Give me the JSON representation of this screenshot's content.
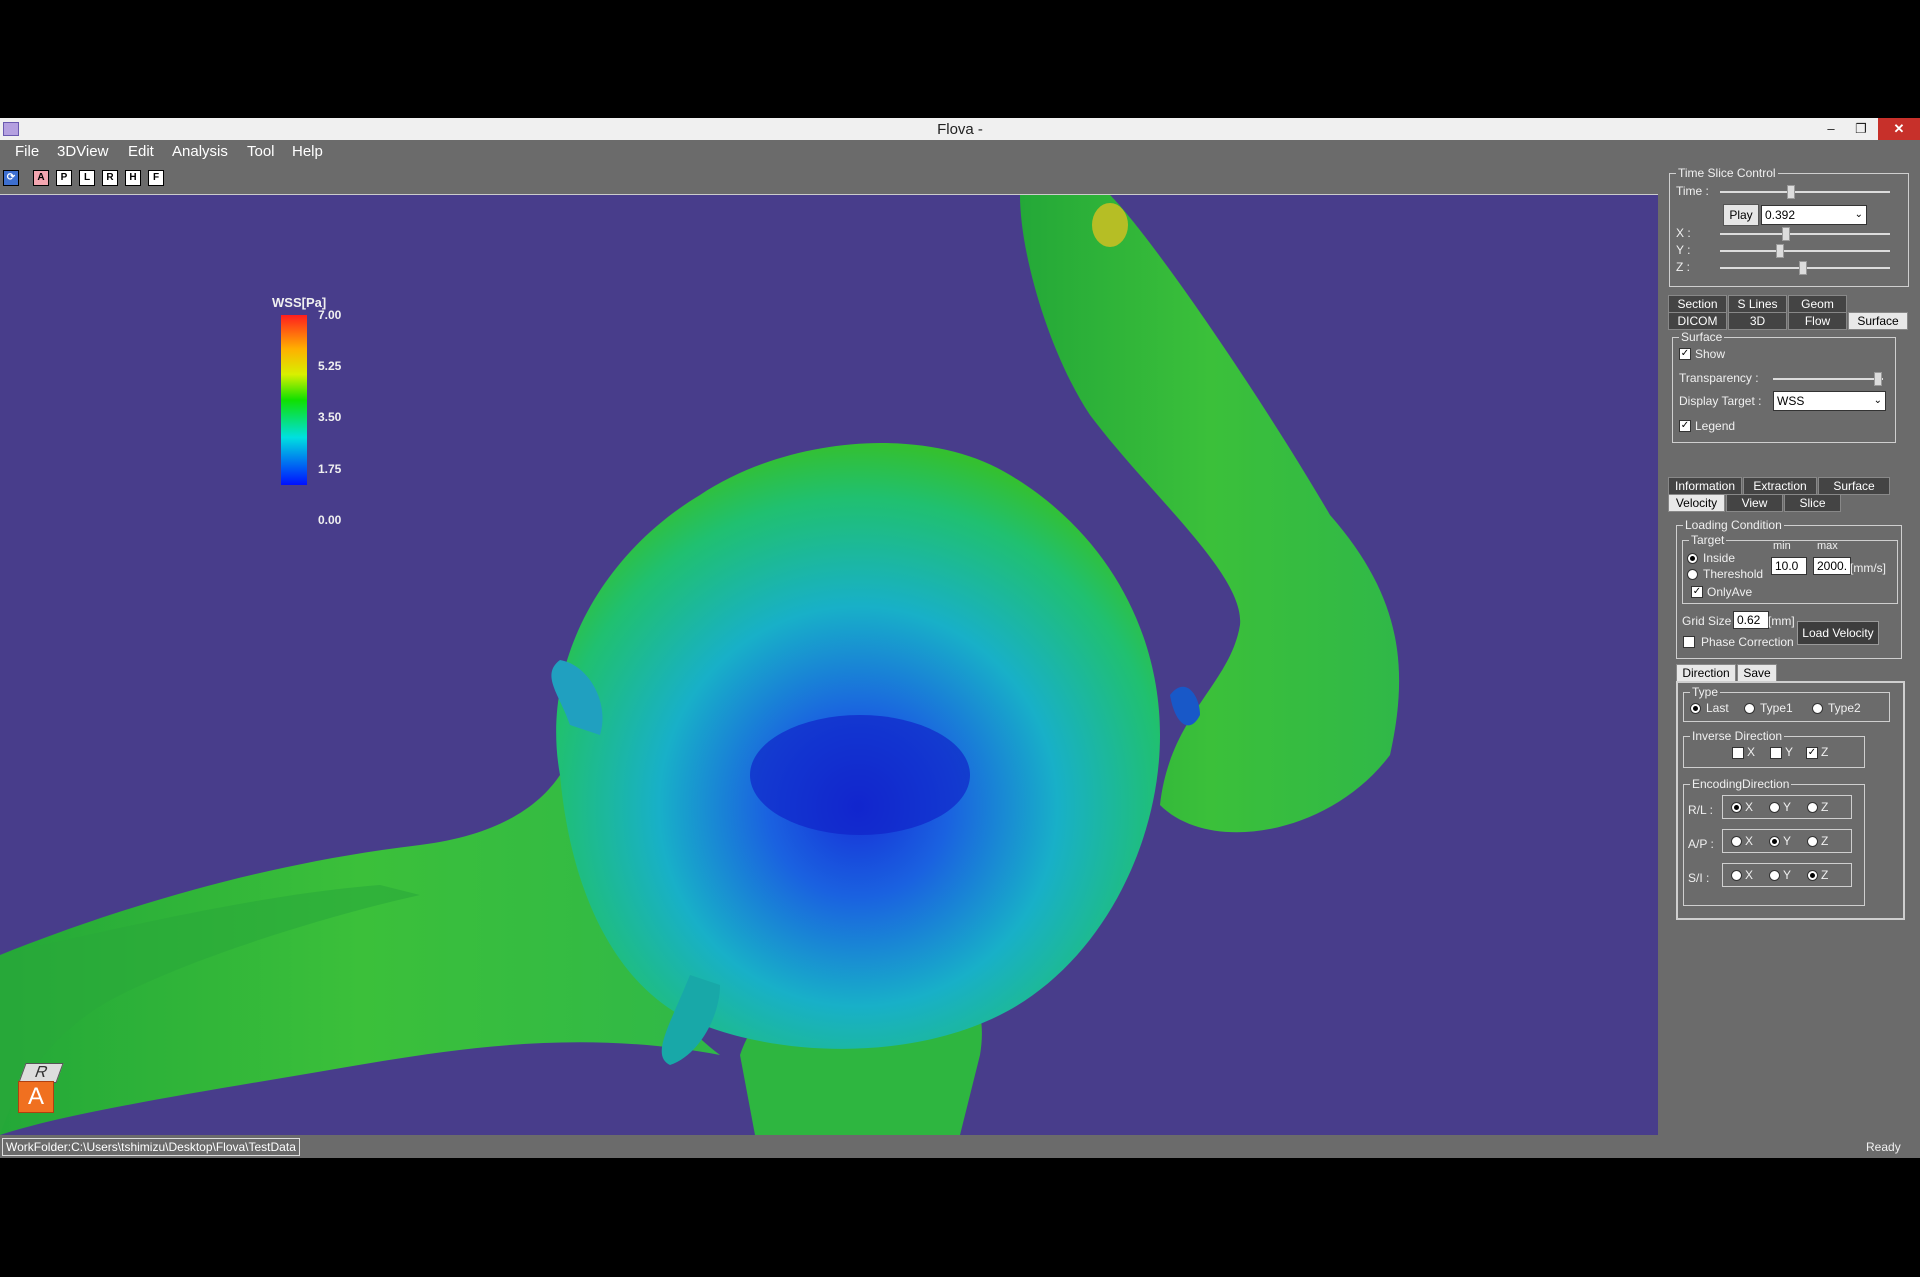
{
  "window": {
    "title": "Flova -",
    "close": "✕",
    "minimize": "–",
    "maximize": "❐"
  },
  "menu": [
    "File",
    "3DView",
    "Edit",
    "Analysis",
    "Tool",
    "Help"
  ],
  "toolbar": [
    "A",
    "P",
    "L",
    "R",
    "H",
    "F"
  ],
  "legend": {
    "title": "WSS[Pa]",
    "ticks": [
      "7.00",
      "5.25",
      "3.50",
      "1.75",
      "0.00"
    ]
  },
  "orientation_cube": {
    "top": "R",
    "front": "A"
  },
  "time_slice": {
    "title": "Time Slice Control",
    "time_label": "Time :",
    "play": "Play",
    "time_value": "0.392",
    "x_label": "X :",
    "y_label": "Y :",
    "z_label": "Z :",
    "time_level": 0.42,
    "x_level": 0.39,
    "y_level": 0.35,
    "z_level": 0.49
  },
  "tabs_top": {
    "row1": [
      "Section",
      "S Lines",
      "Geom"
    ],
    "row2": [
      "DICOM",
      "3D",
      "Flow",
      "Surface"
    ]
  },
  "surface": {
    "title": "Surface",
    "show": "Show",
    "transparency": "Transparency :",
    "transparency_level": 0.95,
    "display_target_label": "Display Target :",
    "display_target": "WSS",
    "legend": "Legend"
  },
  "tabs_mid": {
    "row1": [
      "Information",
      "Extraction",
      "Surface"
    ],
    "row2": [
      "Velocity",
      "View",
      "Slice"
    ]
  },
  "loading": {
    "title": "Loading Condition",
    "target_title": "Target",
    "inside": "Inside",
    "threshold": "Thereshold",
    "min_label": "min",
    "max_label": "max",
    "min_value": "10.0",
    "max_value": "2000.",
    "unit": "[mm/s]",
    "onlyave": "OnlyAve",
    "grid_label": "Grid Size :",
    "grid_value": "0.62",
    "grid_unit": "[mm]",
    "phase": "Phase Correction",
    "load": "Load Velocity"
  },
  "direction_tabs": [
    "Direction",
    "Save"
  ],
  "type": {
    "title": "Type",
    "options": [
      "Last",
      "Type1",
      "Type2"
    ]
  },
  "inverse": {
    "title": "Inverse Direction",
    "x": "X",
    "y": "Y",
    "z": "Z"
  },
  "encoding": {
    "title": "EncodingDirection",
    "rows": [
      {
        "label": "R/L :",
        "x": "X",
        "y": "Y",
        "z": "Z"
      },
      {
        "label": "A/P :",
        "x": "X",
        "y": "Y",
        "z": "Z"
      },
      {
        "label": "S/I :",
        "x": "X",
        "y": "Y",
        "z": "Z"
      }
    ]
  },
  "status": {
    "path": "WorkFolder:C:\\Users\\tshimizu\\Desktop\\Flova\\TestData",
    "state": "Ready"
  },
  "colors": {
    "background": "#483d8b",
    "panel": "#6b6b6b",
    "close": "#c7302a"
  }
}
